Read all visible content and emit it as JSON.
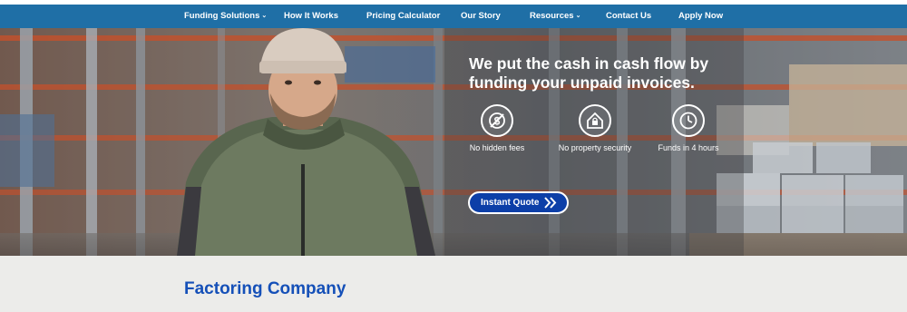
{
  "nav": {
    "items": [
      {
        "label": "Funding Solutions",
        "dropdown": true
      },
      {
        "label": "How It Works",
        "dropdown": false
      },
      {
        "label": "Pricing Calculator",
        "dropdown": false
      },
      {
        "label": "Our Story",
        "dropdown": false
      },
      {
        "label": "Resources",
        "dropdown": true
      },
      {
        "label": "Contact Us",
        "dropdown": false
      },
      {
        "label": "Apply Now",
        "dropdown": false
      }
    ],
    "background_color": "#1f6fa6",
    "chevron_icon": "chevron-down-icon"
  },
  "hero": {
    "headline": "We put the cash in cash flow by funding your unpaid invoices.",
    "features": [
      {
        "icon": "no-dollar-icon",
        "label": "No hidden fees"
      },
      {
        "icon": "house-lock-icon",
        "label": "No property security"
      },
      {
        "icon": "clock-icon",
        "label": "Funds in 4 hours"
      }
    ],
    "cta_label": "Instant Quote",
    "cta_icon": "double-chevron-right-icon",
    "cta_color": "#0c3fa8"
  },
  "content": {
    "title": "Factoring Company",
    "title_color": "#1550b8"
  }
}
